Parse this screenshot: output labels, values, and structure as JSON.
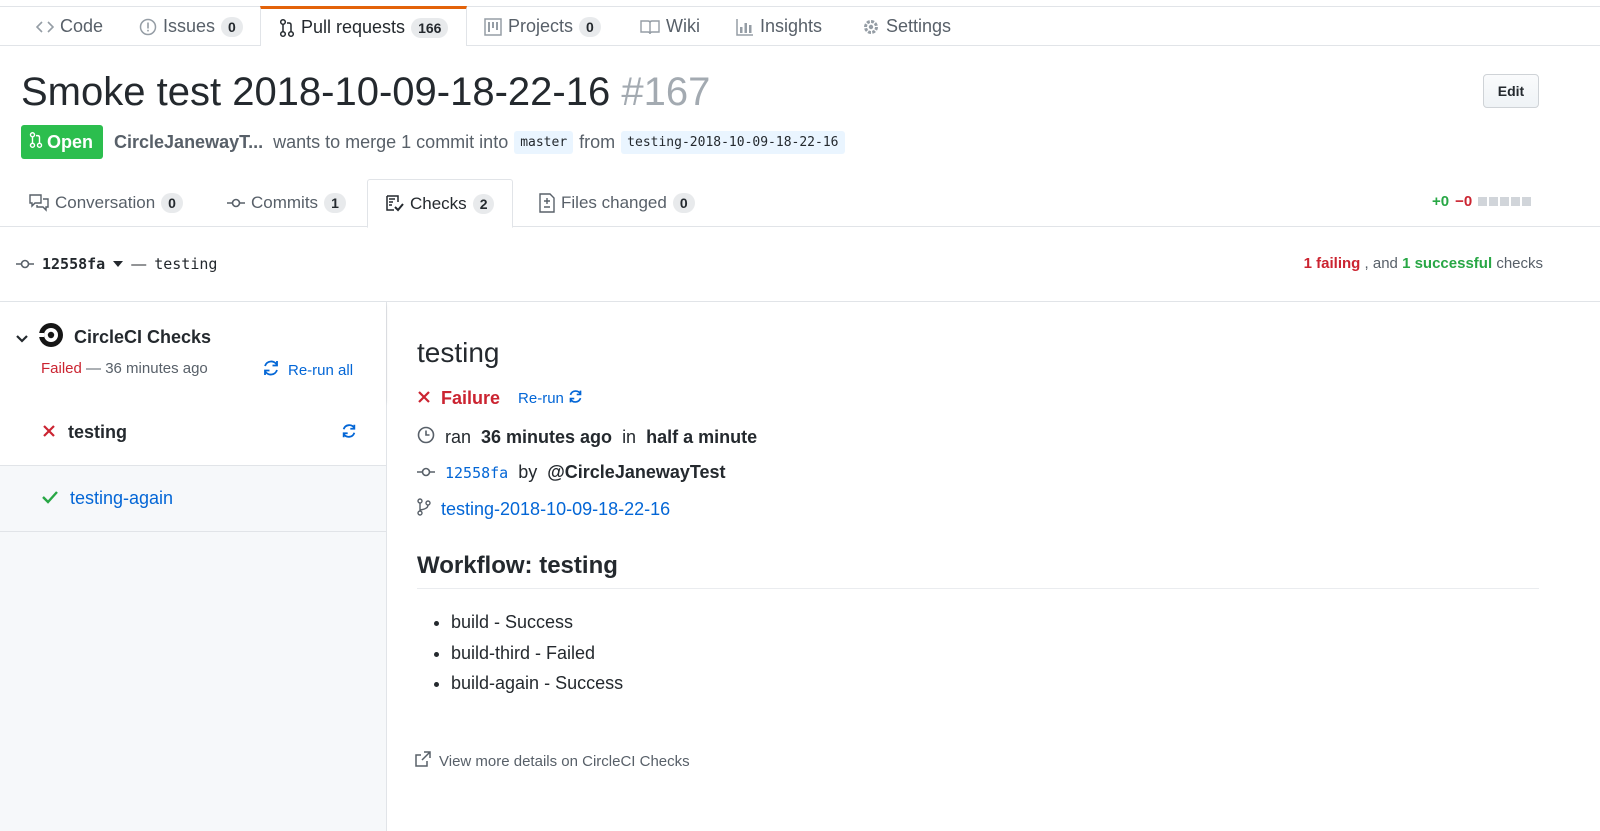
{
  "repo_nav": {
    "code": "Code",
    "issues": "Issues",
    "issues_count": "0",
    "pull_requests": "Pull requests",
    "pull_requests_count": "166",
    "projects": "Projects",
    "projects_count": "0",
    "wiki": "Wiki",
    "insights": "Insights",
    "settings": "Settings"
  },
  "pr": {
    "title": "Smoke test 2018-10-09-18-22-16",
    "number": "#167",
    "edit_label": "Edit",
    "state": "Open",
    "author": "CircleJanewayT...",
    "merge_text": "wants to merge 1 commit into",
    "base_branch": "master",
    "from_text": "from",
    "head_branch": "testing-2018-10-09-18-22-16"
  },
  "pr_tabs": {
    "conversation": "Conversation",
    "conversation_count": "0",
    "commits": "Commits",
    "commits_count": "1",
    "checks": "Checks",
    "checks_count": "2",
    "files_changed": "Files changed",
    "files_changed_count": "0"
  },
  "diffstat": {
    "additions": "+0",
    "deletions": "−0"
  },
  "commit_bar": {
    "sha": "12558fa",
    "separator": "—",
    "branch": "testing",
    "failing": "1 failing",
    "and_text": ", and",
    "successful": "1 successful",
    "checks_text": "checks"
  },
  "sidebar": {
    "suite_name": "CircleCI Checks",
    "suite_status": "Failed",
    "suite_time": "— 36 minutes ago",
    "rerun_all": "Re-run all",
    "runs": [
      {
        "name": "testing",
        "status": "failure"
      },
      {
        "name": "testing-again",
        "status": "success"
      }
    ]
  },
  "check": {
    "name": "testing",
    "conclusion": "Failure",
    "rerun": "Re-run",
    "ran_prefix": "ran",
    "ran_when": "36 minutes ago",
    "in_text": "in",
    "duration": "half a minute",
    "sha": "12558fa",
    "by_text": "by",
    "user": "@CircleJanewayTest",
    "branch": "testing-2018-10-09-18-22-16",
    "workflow_title": "Workflow: testing",
    "jobs": [
      "build - Success",
      "build-third - Failed",
      "build-again - Success"
    ],
    "details_link": "View more details on CircleCI Checks"
  },
  "colors": {
    "open_green": "#2cbe4e",
    "failure_red": "#cb2431",
    "success_green": "#28a745",
    "link_blue": "#0366d6",
    "tab_accent": "#e36209"
  }
}
